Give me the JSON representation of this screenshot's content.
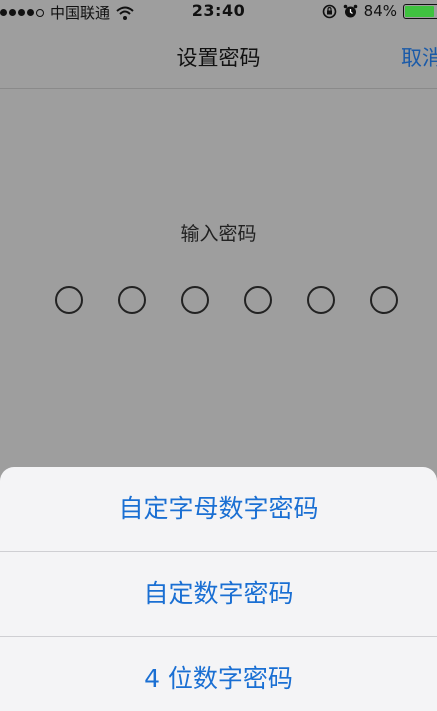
{
  "status_bar": {
    "carrier": "中国联通",
    "time": "23:40",
    "battery_percent": "84%",
    "battery_level": 0.84,
    "signal_dots_filled": 4,
    "signal_dots_total": 5
  },
  "nav": {
    "title": "设置密码",
    "cancel_label": "取消"
  },
  "passcode": {
    "prompt": "输入密码",
    "digit_count": 6
  },
  "action_sheet": {
    "options": [
      {
        "label": "自定字母数字密码"
      },
      {
        "label": "自定数字密码"
      },
      {
        "label": "4 位数字密码"
      }
    ]
  },
  "colors": {
    "accent": "#1a6fd3",
    "nav_accent": "#1a5aa8",
    "battery": "#3fc23f",
    "dimmed_background": "#9e9e9e",
    "sheet_background": "#f4f4f6"
  },
  "icons": [
    "wifi-icon",
    "orientation-lock-icon",
    "alarm-icon",
    "battery-icon"
  ]
}
